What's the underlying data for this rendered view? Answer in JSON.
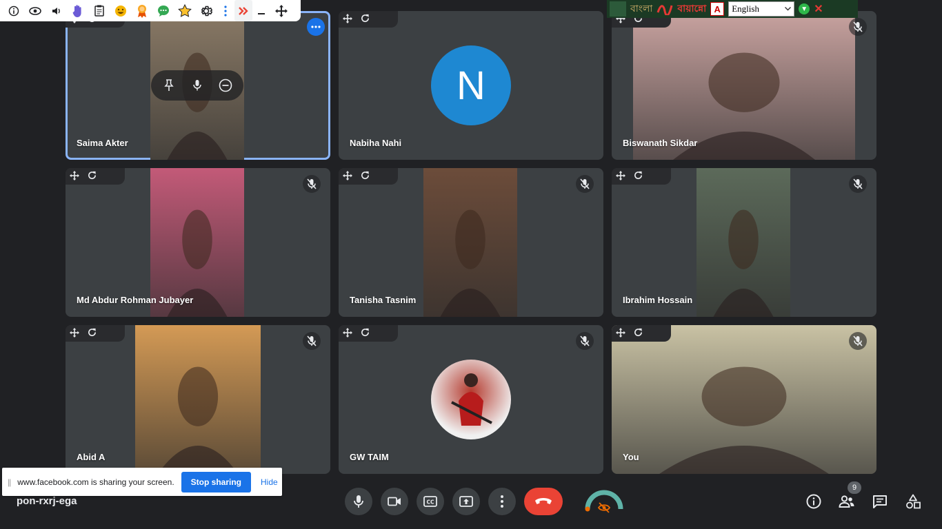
{
  "extension_toolbar": {
    "icons": [
      "info-icon",
      "eye-icon",
      "speaker-icon",
      "hand-icon",
      "clipboard-icon",
      "emoji-icon",
      "award-icon",
      "chat-bubble-icon",
      "star-icon",
      "gear-icon",
      "kebab-icon",
      "double-chevron-icon",
      "minimize-icon",
      "move-icon"
    ]
  },
  "ime_bar": {
    "bangla_label": "বাংলা",
    "avro_label": "বায়ান্নো",
    "language_select": "English"
  },
  "participants": [
    {
      "name": "Saima Akter",
      "type": "video",
      "video_color": "#8a7a66",
      "active": true
    },
    {
      "name": "Nabiha Nahi",
      "type": "avatar",
      "avatar_letter": "N",
      "avatar_color": "#1e88d2"
    },
    {
      "name": "Biswanath Sikdar",
      "type": "video",
      "video_color": "#c9a3a0"
    },
    {
      "name": "Md Abdur Rohman Jubayer",
      "type": "video",
      "video_color": "#c35a78"
    },
    {
      "name": "Tanisha Tasnim",
      "type": "video",
      "video_color": "#6c4c3a"
    },
    {
      "name": "Ibrahim Hossain",
      "type": "video",
      "video_color": "#5c6a5a"
    },
    {
      "name": "Abid A",
      "type": "video",
      "video_color": "#d49a55"
    },
    {
      "name": "GW TAIM",
      "type": "avatar-image",
      "avatar_color": "#b43a2e"
    },
    {
      "name": "You",
      "type": "video",
      "video_color": "#c9c2a4"
    }
  ],
  "bottom_bar": {
    "meeting_code": "pon-rxrj-ega",
    "participant_count": "9"
  },
  "share_notice": {
    "message": "www.facebook.com is sharing your screen.",
    "stop_label": "Stop sharing",
    "hide_label": "Hide"
  }
}
